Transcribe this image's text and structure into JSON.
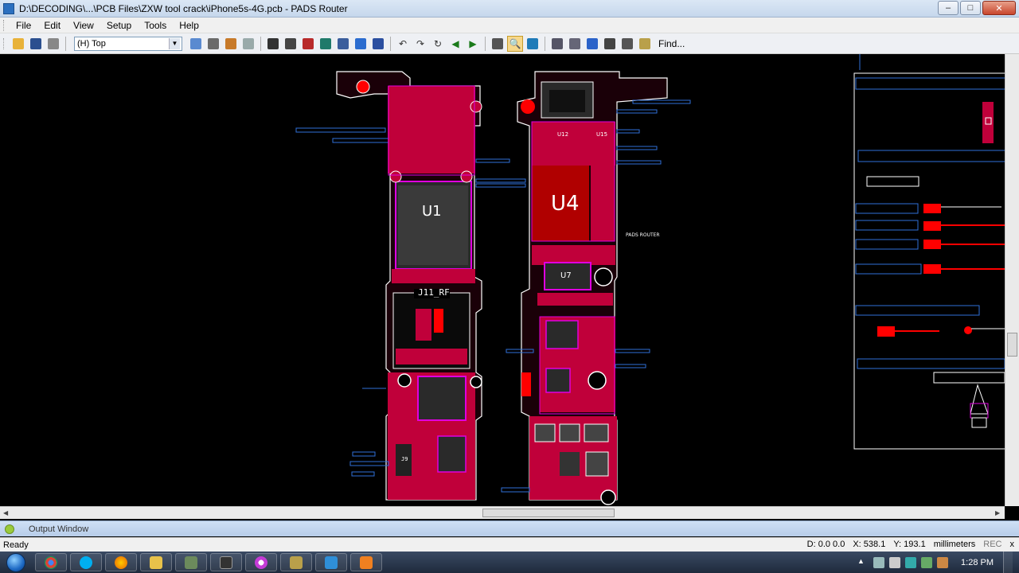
{
  "window": {
    "title": "D:\\DECODING\\...\\PCB Files\\ZXW tool crack\\iPhone5s-4G.pcb - PADS Router",
    "minimize": "–",
    "maximize": "□",
    "close": "✕"
  },
  "menu": {
    "items": [
      "File",
      "Edit",
      "View",
      "Setup",
      "Tools",
      "Help"
    ]
  },
  "toolbar": {
    "layer_value": "(H) Top",
    "find_label": "Find..."
  },
  "canvas": {
    "labels": {
      "u1": "U1",
      "u4": "U4",
      "u7": "U7",
      "u12": "U12",
      "u15": "U15",
      "j11": "J11_RF",
      "notes": "PADS ROUTER",
      "j9": "J9"
    }
  },
  "output_window": {
    "label": "Output Window"
  },
  "status": {
    "ready": "Ready",
    "d": "D: 0.0 0.0",
    "x": "X: 538.1",
    "y": "Y: 193.1",
    "units": "millimeters",
    "rec": "REC",
    "close": "x"
  },
  "taskbar": {
    "time": "1:28 PM"
  },
  "colors": {
    "board_fill": "#e00030",
    "board_outline": "#ffffff",
    "trace_blue": "#2f6fd8",
    "pad_red": "#ff0000",
    "magenta": "#e000e0",
    "canvas_bg": "#000000"
  }
}
